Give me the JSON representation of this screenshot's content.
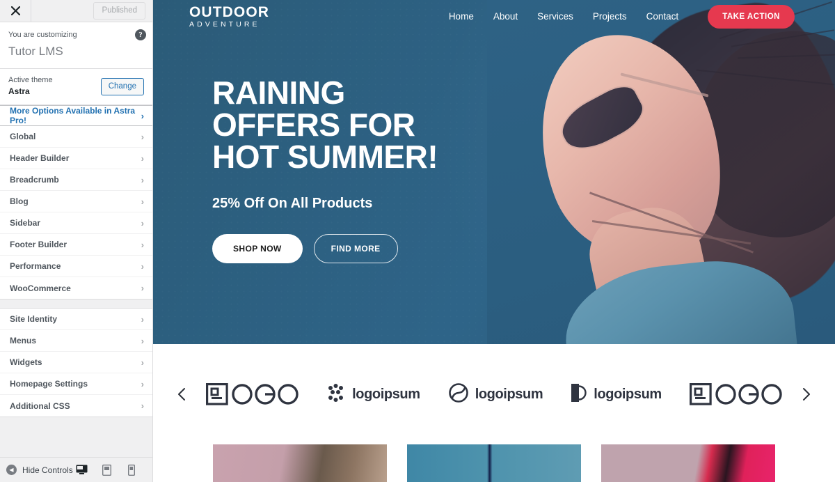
{
  "customizer": {
    "close_icon": "close-x-icon",
    "published_label": "Published",
    "info": {
      "label": "You are customizing",
      "title": "Tutor LMS",
      "help_icon": "help-question-icon"
    },
    "theme": {
      "label": "Active theme",
      "name": "Astra",
      "change_label": "Change"
    },
    "promo": {
      "label": "More Options Available in Astra Pro!"
    },
    "groups": [
      {
        "items": [
          {
            "label": "Global"
          },
          {
            "label": "Header Builder"
          },
          {
            "label": "Breadcrumb"
          },
          {
            "label": "Blog"
          },
          {
            "label": "Sidebar"
          },
          {
            "label": "Footer Builder"
          },
          {
            "label": "Performance"
          },
          {
            "label": "WooCommerce"
          }
        ]
      },
      {
        "items": [
          {
            "label": "Site Identity"
          },
          {
            "label": "Menus"
          },
          {
            "label": "Widgets"
          },
          {
            "label": "Homepage Settings"
          },
          {
            "label": "Additional CSS"
          }
        ]
      }
    ],
    "bottom": {
      "hide_controls_label": "Hide Controls",
      "devices": [
        {
          "name": "desktop-preview",
          "icon": "desktop-icon",
          "active": true
        },
        {
          "name": "tablet-preview",
          "icon": "tablet-icon",
          "active": false
        },
        {
          "name": "mobile-preview",
          "icon": "mobile-icon",
          "active": false
        }
      ]
    },
    "colors": {
      "link": "#2271b1",
      "panel_bg": "#f0f0f1",
      "border": "#dcdcde"
    }
  },
  "preview": {
    "site": {
      "logo_main": "OUTDOOR",
      "logo_sub": "ADVENTURE",
      "nav": [
        {
          "label": "Home"
        },
        {
          "label": "About"
        },
        {
          "label": "Services"
        },
        {
          "label": "Projects"
        },
        {
          "label": "Contact"
        }
      ],
      "cta_label": "TAKE ACTION",
      "cta_color": "#e6394f"
    },
    "hero": {
      "heading_line1": "RAINING",
      "heading_line2": "OFFERS FOR",
      "heading_line3": "HOT SUMMER!",
      "subheading": "25% Off On All Products",
      "primary_button": "SHOP NOW",
      "secondary_button": "FIND MORE",
      "background_color": "#2c5f80"
    },
    "logo_carousel": {
      "prev_icon": "chevron-left-icon",
      "next_icon": "chevron-right-icon",
      "logos": [
        {
          "name": "logo-square-circles",
          "text": "LOGO",
          "mark": "square-circle-mark"
        },
        {
          "name": "logo-logoipsum-dots",
          "text": "logoipsum",
          "mark": "dots-grid-mark"
        },
        {
          "name": "logo-logoipsum-swirl",
          "text": "logoipsum",
          "mark": "swirl-circle-mark"
        },
        {
          "name": "logo-logoipsum-half",
          "text": "logoipsum",
          "mark": "half-moon-mark"
        },
        {
          "name": "logo-square-circles-2",
          "text": "LOGO",
          "mark": "square-circle-mark"
        }
      ]
    },
    "products": [
      {
        "name": "product-card-1"
      },
      {
        "name": "product-card-2"
      },
      {
        "name": "product-card-3"
      }
    ]
  }
}
